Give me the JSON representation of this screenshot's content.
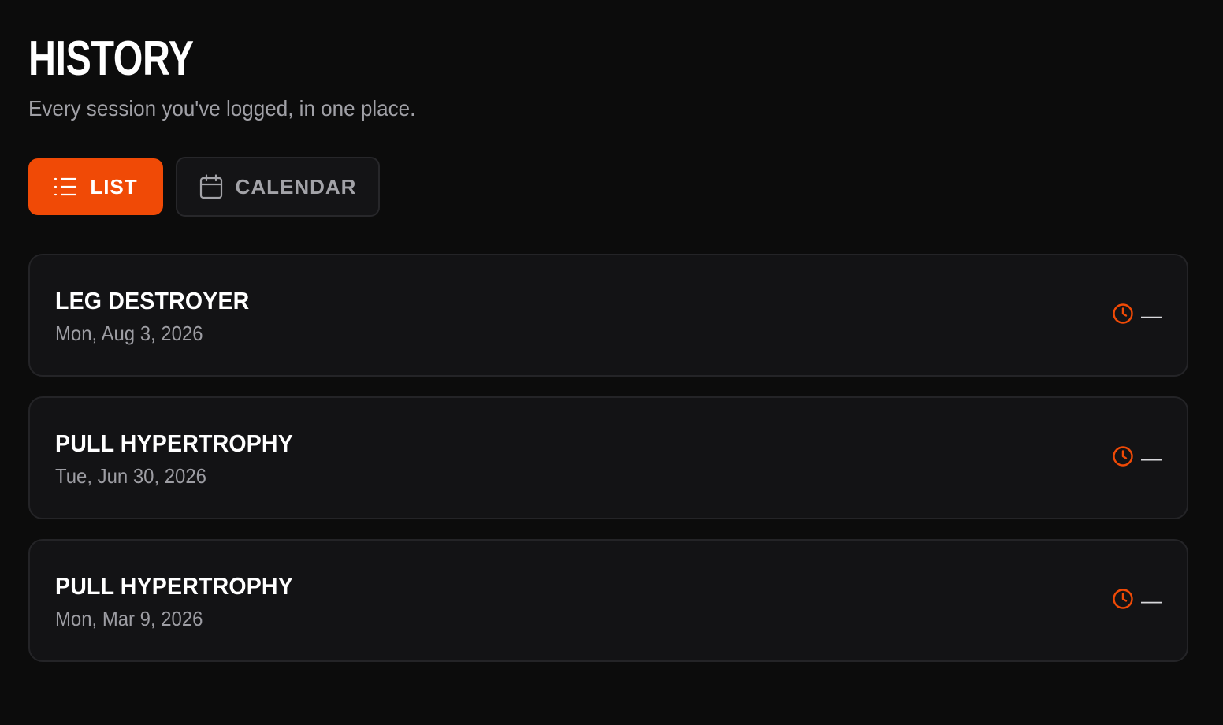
{
  "header": {
    "title": "HISTORY",
    "subtitle": "Every session you've logged, in one place."
  },
  "view_toggle": {
    "list_label": "LIST",
    "calendar_label": "CALENDAR",
    "selected": "LIST"
  },
  "sessions": [
    {
      "name": "LEG DESTROYER",
      "date": "Mon, Aug 3, 2026",
      "duration": "—"
    },
    {
      "name": "PULL HYPERTROPHY",
      "date": "Tue, Jun 30, 2026",
      "duration": "—"
    },
    {
      "name": "PULL HYPERTROPHY",
      "date": "Mon, Mar 9, 2026",
      "duration": "—"
    }
  ],
  "icons": {
    "list": "list-icon",
    "calendar": "calendar-icon",
    "duration": "clock-icon"
  },
  "colors": {
    "background": "#0c0c0c",
    "accent": "#f04a06",
    "card_background": "#131315",
    "card_border": "#242427",
    "muted_text": "#9d9da3"
  }
}
